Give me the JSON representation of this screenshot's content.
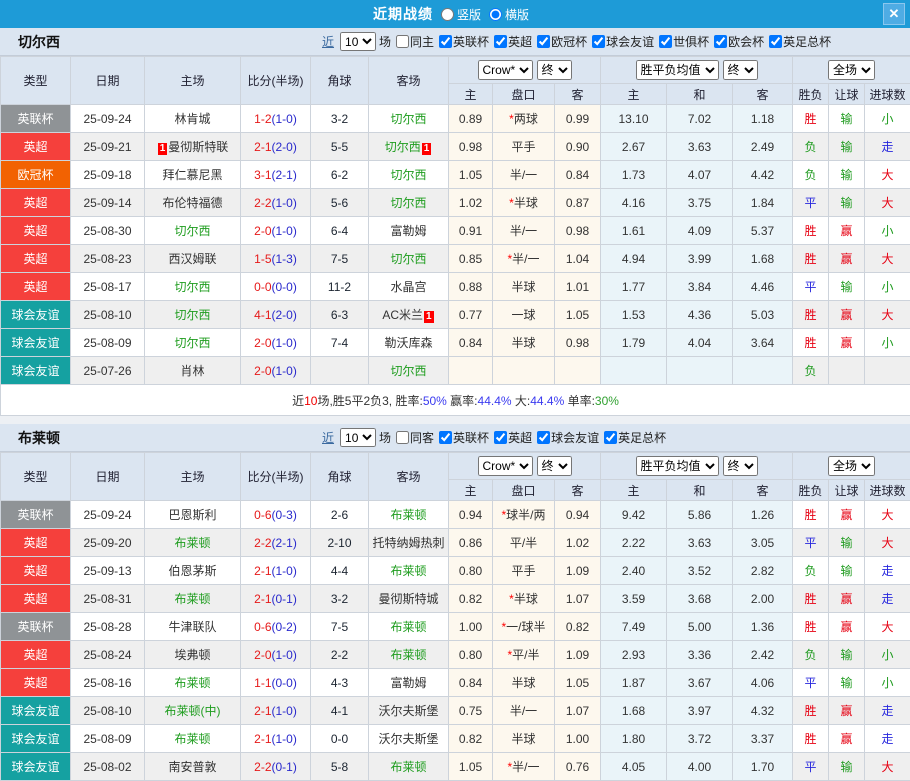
{
  "titlebar": {
    "title": "近期战绩",
    "radio_vertical": "竖版",
    "radio_horizontal": "横版",
    "selected": "横版",
    "close_label": "✕"
  },
  "table": {
    "columns": [
      "类型",
      "日期",
      "主场",
      "比分(半场)",
      "角球",
      "客场"
    ],
    "sub_columns": [
      "主",
      "盘口",
      "客",
      "主",
      "和",
      "客",
      "胜负",
      "让球",
      "进球数"
    ],
    "selects": {
      "crow": "Crow*",
      "final1": "终",
      "avg": "胜平负均值",
      "final2": "终",
      "scope": "全场"
    }
  },
  "colors": {
    "accent_blue": "#1E9BD7",
    "type": {
      "epl": "#F5403C",
      "league_cup": "#8F9396",
      "ucl": "#F26202",
      "friendly": "#15A1A1"
    },
    "result": {
      "r": "#E60012",
      "g": "#1E9B1E",
      "b": "#2727DD"
    },
    "score_main": "#E61919",
    "score_half": "#2929CC",
    "team_subject": "#1F9D1F",
    "odds_bg": "#FDF8EE",
    "euro_bg": "#EAF4F9",
    "summary_blue": "#3A3AF0",
    "summary_green": "#2FA02F",
    "summary_red": "#F00000"
  },
  "sections": [
    {
      "team": "切尔西",
      "filter": {
        "recent_label": "近",
        "count": "10",
        "games_label": "场",
        "same_label": "同主",
        "leagues": [
          "英联杯",
          "英超",
          "欧冠杯",
          "球会友谊",
          "世俱杯",
          "欧会杯",
          "英足总杯"
        ]
      },
      "rows": [
        {
          "type": "英联杯",
          "tc": "league_cup",
          "date": "25-09-24",
          "home": "林肯城",
          "hs": false,
          "hb": "",
          "s": "1-2",
          "h": "(1-0)",
          "c": "3-2",
          "away": "切尔西",
          "as": true,
          "ab": "",
          "o1": "0.89",
          "op": "*两球",
          "o2": "0.99",
          "e1": "13.10",
          "e2": "7.02",
          "e3": "1.18",
          "r": [
            "胜",
            "r"
          ],
          "hr": [
            "输",
            "g"
          ],
          "gr": [
            "小",
            "g"
          ]
        },
        {
          "type": "英超",
          "tc": "epl",
          "date": "25-09-21",
          "home": "曼彻斯特联",
          "hs": false,
          "hb": "1",
          "s": "2-1",
          "h": "(2-0)",
          "c": "5-5",
          "away": "切尔西",
          "as": true,
          "ab": "1",
          "o1": "0.98",
          "op": "平手",
          "o2": "0.90",
          "e1": "2.67",
          "e2": "3.63",
          "e3": "2.49",
          "r": [
            "负",
            "g"
          ],
          "hr": [
            "输",
            "g"
          ],
          "gr": [
            "走",
            "b"
          ]
        },
        {
          "type": "欧冠杯",
          "tc": "ucl",
          "date": "25-09-18",
          "home": "拜仁慕尼黑",
          "hs": false,
          "hb": "",
          "s": "3-1",
          "h": "(2-1)",
          "c": "6-2",
          "away": "切尔西",
          "as": true,
          "ab": "",
          "o1": "1.05",
          "op": "半/一",
          "o2": "0.84",
          "e1": "1.73",
          "e2": "4.07",
          "e3": "4.42",
          "r": [
            "负",
            "g"
          ],
          "hr": [
            "输",
            "g"
          ],
          "gr": [
            "大",
            "r"
          ]
        },
        {
          "type": "英超",
          "tc": "epl",
          "date": "25-09-14",
          "home": "布伦特福德",
          "hs": false,
          "hb": "",
          "s": "2-2",
          "h": "(1-0)",
          "c": "5-6",
          "away": "切尔西",
          "as": true,
          "ab": "",
          "o1": "1.02",
          "op": "*半球",
          "o2": "0.87",
          "e1": "4.16",
          "e2": "3.75",
          "e3": "1.84",
          "r": [
            "平",
            "b"
          ],
          "hr": [
            "输",
            "g"
          ],
          "gr": [
            "大",
            "r"
          ]
        },
        {
          "type": "英超",
          "tc": "epl",
          "date": "25-08-30",
          "home": "切尔西",
          "hs": true,
          "hb": "",
          "s": "2-0",
          "h": "(1-0)",
          "c": "6-4",
          "away": "富勒姆",
          "as": false,
          "ab": "",
          "o1": "0.91",
          "op": "半/一",
          "o2": "0.98",
          "e1": "1.61",
          "e2": "4.09",
          "e3": "5.37",
          "r": [
            "胜",
            "r"
          ],
          "hr": [
            "赢",
            "r"
          ],
          "gr": [
            "小",
            "g"
          ]
        },
        {
          "type": "英超",
          "tc": "epl",
          "date": "25-08-23",
          "home": "西汉姆联",
          "hs": false,
          "hb": "",
          "s": "1-5",
          "h": "(1-3)",
          "c": "7-5",
          "away": "切尔西",
          "as": true,
          "ab": "",
          "o1": "0.85",
          "op": "*半/一",
          "o2": "1.04",
          "e1": "4.94",
          "e2": "3.99",
          "e3": "1.68",
          "r": [
            "胜",
            "r"
          ],
          "hr": [
            "赢",
            "r"
          ],
          "gr": [
            "大",
            "r"
          ]
        },
        {
          "type": "英超",
          "tc": "epl",
          "date": "25-08-17",
          "home": "切尔西",
          "hs": true,
          "hb": "",
          "s": "0-0",
          "h": "(0-0)",
          "c": "11-2",
          "away": "水晶宫",
          "as": false,
          "ab": "",
          "o1": "0.88",
          "op": "半球",
          "o2": "1.01",
          "e1": "1.77",
          "e2": "3.84",
          "e3": "4.46",
          "r": [
            "平",
            "b"
          ],
          "hr": [
            "输",
            "g"
          ],
          "gr": [
            "小",
            "g"
          ]
        },
        {
          "type": "球会友谊",
          "tc": "friendly",
          "date": "25-08-10",
          "home": "切尔西",
          "hs": true,
          "hb": "",
          "s": "4-1",
          "h": "(2-0)",
          "c": "6-3",
          "away": "AC米兰",
          "as": false,
          "ab": "1",
          "o1": "0.77",
          "op": "一球",
          "o2": "1.05",
          "e1": "1.53",
          "e2": "4.36",
          "e3": "5.03",
          "r": [
            "胜",
            "r"
          ],
          "hr": [
            "赢",
            "r"
          ],
          "gr": [
            "大",
            "r"
          ]
        },
        {
          "type": "球会友谊",
          "tc": "friendly",
          "date": "25-08-09",
          "home": "切尔西",
          "hs": true,
          "hb": "",
          "s": "2-0",
          "h": "(1-0)",
          "c": "7-4",
          "away": "勒沃库森",
          "as": false,
          "ab": "",
          "o1": "0.84",
          "op": "半球",
          "o2": "0.98",
          "e1": "1.79",
          "e2": "4.04",
          "e3": "3.64",
          "r": [
            "胜",
            "r"
          ],
          "hr": [
            "赢",
            "r"
          ],
          "gr": [
            "小",
            "g"
          ]
        },
        {
          "type": "球会友谊",
          "tc": "friendly",
          "date": "25-07-26",
          "home": "肖林",
          "hs": false,
          "hb": "",
          "s": "2-0",
          "h": "(1-0)",
          "c": "",
          "away": "切尔西",
          "as": true,
          "ab": "",
          "o1": "",
          "op": "",
          "o2": "",
          "e1": "",
          "e2": "",
          "e3": "",
          "r": [
            "负",
            "g"
          ],
          "hr": [
            "",
            ""
          ],
          "gr": [
            "",
            ""
          ]
        }
      ],
      "summary": [
        {
          "t": "近",
          "c": "#333333"
        },
        {
          "t": "10",
          "c": "#F00000"
        },
        {
          "t": "场,胜5平2负3, 胜率:",
          "c": "#333333"
        },
        {
          "t": "50%",
          "c": "#3A3AF0"
        },
        {
          "t": " 赢率:",
          "c": "#333333"
        },
        {
          "t": "44.4%",
          "c": "#3A3AF0"
        },
        {
          "t": " 大:",
          "c": "#333333"
        },
        {
          "t": "44.4%",
          "c": "#3A3AF0"
        },
        {
          "t": " 单率:",
          "c": "#333333"
        },
        {
          "t": "30%",
          "c": "#2FA02F"
        }
      ]
    },
    {
      "team": "布莱顿",
      "filter": {
        "recent_label": "近",
        "count": "10",
        "games_label": "场",
        "same_label": "同客",
        "leagues": [
          "英联杯",
          "英超",
          "球会友谊",
          "英足总杯"
        ]
      },
      "rows": [
        {
          "type": "英联杯",
          "tc": "league_cup",
          "date": "25-09-24",
          "home": "巴恩斯利",
          "hs": false,
          "hb": "",
          "s": "0-6",
          "h": "(0-3)",
          "c": "2-6",
          "away": "布莱顿",
          "as": true,
          "ab": "",
          "o1": "0.94",
          "op": "*球半/两",
          "o2": "0.94",
          "e1": "9.42",
          "e2": "5.86",
          "e3": "1.26",
          "r": [
            "胜",
            "r"
          ],
          "hr": [
            "赢",
            "r"
          ],
          "gr": [
            "大",
            "r"
          ]
        },
        {
          "type": "英超",
          "tc": "epl",
          "date": "25-09-20",
          "home": "布莱顿",
          "hs": true,
          "hb": "",
          "s": "2-2",
          "h": "(2-1)",
          "c": "2-10",
          "away": "托特纳姆热刺",
          "as": false,
          "ab": "",
          "o1": "0.86",
          "op": "平/半",
          "o2": "1.02",
          "e1": "2.22",
          "e2": "3.63",
          "e3": "3.05",
          "r": [
            "平",
            "b"
          ],
          "hr": [
            "输",
            "g"
          ],
          "gr": [
            "大",
            "r"
          ]
        },
        {
          "type": "英超",
          "tc": "epl",
          "date": "25-09-13",
          "home": "伯恩茅斯",
          "hs": false,
          "hb": "",
          "s": "2-1",
          "h": "(1-0)",
          "c": "4-4",
          "away": "布莱顿",
          "as": true,
          "ab": "",
          "o1": "0.80",
          "op": "平手",
          "o2": "1.09",
          "e1": "2.40",
          "e2": "3.52",
          "e3": "2.82",
          "r": [
            "负",
            "g"
          ],
          "hr": [
            "输",
            "g"
          ],
          "gr": [
            "走",
            "b"
          ]
        },
        {
          "type": "英超",
          "tc": "epl",
          "date": "25-08-31",
          "home": "布莱顿",
          "hs": true,
          "hb": "",
          "s": "2-1",
          "h": "(0-1)",
          "c": "3-2",
          "away": "曼彻斯特城",
          "as": false,
          "ab": "",
          "o1": "0.82",
          "op": "*半球",
          "o2": "1.07",
          "e1": "3.59",
          "e2": "3.68",
          "e3": "2.00",
          "r": [
            "胜",
            "r"
          ],
          "hr": [
            "赢",
            "r"
          ],
          "gr": [
            "走",
            "b"
          ]
        },
        {
          "type": "英联杯",
          "tc": "league_cup",
          "date": "25-08-28",
          "home": "牛津联队",
          "hs": false,
          "hb": "",
          "s": "0-6",
          "h": "(0-2)",
          "c": "7-5",
          "away": "布莱顿",
          "as": true,
          "ab": "",
          "o1": "1.00",
          "op": "*一/球半",
          "o2": "0.82",
          "e1": "7.49",
          "e2": "5.00",
          "e3": "1.36",
          "r": [
            "胜",
            "r"
          ],
          "hr": [
            "赢",
            "r"
          ],
          "gr": [
            "大",
            "r"
          ]
        },
        {
          "type": "英超",
          "tc": "epl",
          "date": "25-08-24",
          "home": "埃弗顿",
          "hs": false,
          "hb": "",
          "s": "2-0",
          "h": "(1-0)",
          "c": "2-2",
          "away": "布莱顿",
          "as": true,
          "ab": "",
          "o1": "0.80",
          "op": "*平/半",
          "o2": "1.09",
          "e1": "2.93",
          "e2": "3.36",
          "e3": "2.42",
          "r": [
            "负",
            "g"
          ],
          "hr": [
            "输",
            "g"
          ],
          "gr": [
            "小",
            "g"
          ]
        },
        {
          "type": "英超",
          "tc": "epl",
          "date": "25-08-16",
          "home": "布莱顿",
          "hs": true,
          "hb": "",
          "s": "1-1",
          "h": "(0-0)",
          "c": "4-3",
          "away": "富勒姆",
          "as": false,
          "ab": "",
          "o1": "0.84",
          "op": "半球",
          "o2": "1.05",
          "e1": "1.87",
          "e2": "3.67",
          "e3": "4.06",
          "r": [
            "平",
            "b"
          ],
          "hr": [
            "输",
            "g"
          ],
          "gr": [
            "小",
            "g"
          ]
        },
        {
          "type": "球会友谊",
          "tc": "friendly",
          "date": "25-08-10",
          "home": "布莱顿(中)",
          "hs": true,
          "hb": "",
          "s": "2-1",
          "h": "(1-0)",
          "c": "4-1",
          "away": "沃尔夫斯堡",
          "as": false,
          "ab": "",
          "o1": "0.75",
          "op": "半/一",
          "o2": "1.07",
          "e1": "1.68",
          "e2": "3.97",
          "e3": "4.32",
          "r": [
            "胜",
            "r"
          ],
          "hr": [
            "赢",
            "r"
          ],
          "gr": [
            "走",
            "b"
          ]
        },
        {
          "type": "球会友谊",
          "tc": "friendly",
          "date": "25-08-09",
          "home": "布莱顿",
          "hs": true,
          "hb": "",
          "s": "2-1",
          "h": "(1-0)",
          "c": "0-0",
          "away": "沃尔夫斯堡",
          "as": false,
          "ab": "",
          "o1": "0.82",
          "op": "半球",
          "o2": "1.00",
          "e1": "1.80",
          "e2": "3.72",
          "e3": "3.37",
          "r": [
            "胜",
            "r"
          ],
          "hr": [
            "赢",
            "r"
          ],
          "gr": [
            "走",
            "b"
          ]
        },
        {
          "type": "球会友谊",
          "tc": "friendly",
          "date": "25-08-02",
          "home": "南安普敦",
          "hs": false,
          "hb": "",
          "s": "2-2",
          "h": "(0-1)",
          "c": "5-8",
          "away": "布莱顿",
          "as": true,
          "ab": "",
          "o1": "1.05",
          "op": "*半/一",
          "o2": "0.76",
          "e1": "4.05",
          "e2": "4.00",
          "e3": "1.70",
          "r": [
            "平",
            "b"
          ],
          "hr": [
            "输",
            "g"
          ],
          "gr": [
            "大",
            "r"
          ]
        }
      ],
      "summary": null
    }
  ]
}
